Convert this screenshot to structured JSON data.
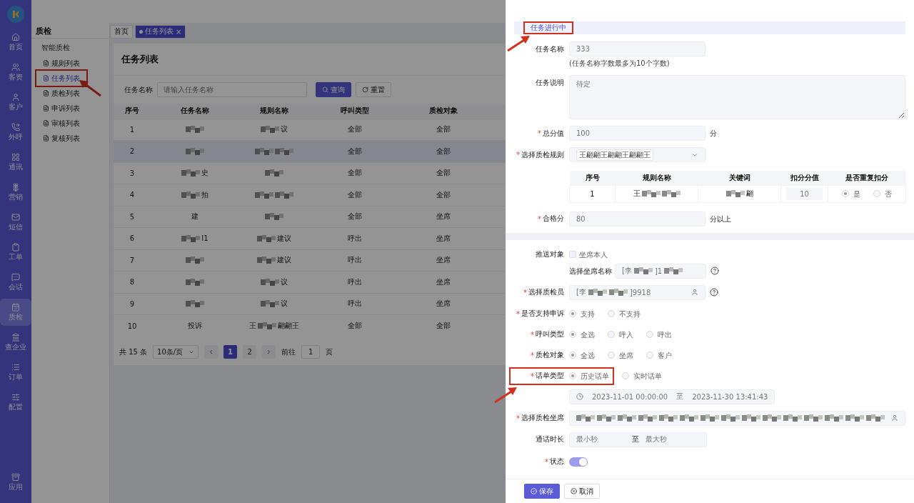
{
  "sidebar": {
    "items": [
      {
        "label": "首页",
        "selected": false
      },
      {
        "label": "客资",
        "selected": false
      },
      {
        "label": "客户",
        "selected": false
      },
      {
        "label": "外呼",
        "selected": false
      },
      {
        "label": "通讯",
        "selected": false
      },
      {
        "label": "营销",
        "selected": false
      },
      {
        "label": "短信",
        "selected": false
      },
      {
        "label": "工单",
        "selected": false
      },
      {
        "label": "会话",
        "selected": false
      },
      {
        "label": "质检",
        "selected": true
      },
      {
        "label": "查企业",
        "selected": false
      },
      {
        "label": "订单",
        "selected": false
      },
      {
        "label": "配置",
        "selected": false
      }
    ],
    "bottom_item": {
      "label": "应用"
    }
  },
  "submenu": {
    "title": "质检",
    "group": "智能质检",
    "items": [
      {
        "label": "规则列表",
        "selected": false,
        "annotated": false
      },
      {
        "label": "任务列表",
        "selected": true,
        "annotated": true
      },
      {
        "label": "质检列表",
        "selected": false,
        "annotated": false
      },
      {
        "label": "申诉列表",
        "selected": false,
        "annotated": false
      },
      {
        "label": "审核列表",
        "selected": false,
        "annotated": false
      },
      {
        "label": "复核列表",
        "selected": false,
        "annotated": false
      }
    ]
  },
  "tabs": [
    {
      "label": "首页",
      "selected": false
    },
    {
      "label": "任务列表",
      "selected": true,
      "close": "×"
    }
  ],
  "page": {
    "title": "任务列表",
    "search": {
      "label": "任务名称",
      "placeholder": "请输入任务名称"
    },
    "buttons": [
      {
        "label": "查询",
        "kind": "primary"
      },
      {
        "label": "重置",
        "kind": "default"
      }
    ]
  },
  "table": {
    "columns": [
      "序号",
      "任务名称",
      "规则名称",
      "呼叫类型",
      "质检对象"
    ],
    "rows": [
      {
        "selected": false,
        "cells": [
          [
            {
              "kind": "text",
              "text": "1"
            }
          ],
          [
            {
              "kind": "redacted"
            }
          ],
          [
            {
              "kind": "redacted"
            },
            {
              "kind": "text",
              "text": "议"
            }
          ],
          [
            {
              "kind": "text",
              "text": "全部"
            }
          ],
          [
            {
              "kind": "text",
              "text": "全部"
            }
          ]
        ]
      },
      {
        "selected": true,
        "cells": [
          [
            {
              "kind": "text",
              "text": "2"
            }
          ],
          [
            {
              "kind": "redacted"
            }
          ],
          [
            {
              "kind": "redacted"
            },
            {
              "kind": "redacted"
            }
          ],
          [
            {
              "kind": "text",
              "text": "全部"
            }
          ],
          [
            {
              "kind": "text",
              "text": "全部"
            }
          ]
        ]
      },
      {
        "selected": false,
        "cells": [
          [
            {
              "kind": "text",
              "text": "3"
            }
          ],
          [
            {
              "kind": "redacted"
            },
            {
              "kind": "text",
              "text": "史"
            }
          ],
          [
            {
              "kind": "redacted"
            }
          ],
          [
            {
              "kind": "text",
              "text": "全部"
            }
          ],
          [
            {
              "kind": "text",
              "text": "全部"
            }
          ]
        ]
      },
      {
        "selected": false,
        "cells": [
          [
            {
              "kind": "text",
              "text": "4"
            }
          ],
          [
            {
              "kind": "redacted"
            },
            {
              "kind": "text",
              "text": "拍"
            }
          ],
          [
            {
              "kind": "redacted"
            },
            {
              "kind": "redacted"
            }
          ],
          [
            {
              "kind": "text",
              "text": "全部"
            }
          ],
          [
            {
              "kind": "text",
              "text": "全部"
            }
          ]
        ]
      },
      {
        "selected": false,
        "cells": [
          [
            {
              "kind": "text",
              "text": "5"
            }
          ],
          [
            {
              "kind": "text",
              "text": "建"
            }
          ],
          [
            {
              "kind": "redacted"
            }
          ],
          [
            {
              "kind": "text",
              "text": "全部"
            }
          ],
          [
            {
              "kind": "text",
              "text": "坐席"
            }
          ]
        ]
      },
      {
        "selected": false,
        "cells": [
          [
            {
              "kind": "text",
              "text": "6"
            }
          ],
          [
            {
              "kind": "redacted"
            },
            {
              "kind": "text",
              "text": "I1"
            }
          ],
          [
            {
              "kind": "redacted"
            },
            {
              "kind": "text",
              "text": "建议"
            }
          ],
          [
            {
              "kind": "text",
              "text": "呼出"
            }
          ],
          [
            {
              "kind": "text",
              "text": "坐席"
            }
          ]
        ]
      },
      {
        "selected": false,
        "cells": [
          [
            {
              "kind": "text",
              "text": "7"
            }
          ],
          [
            {
              "kind": "redacted"
            }
          ],
          [
            {
              "kind": "redacted"
            },
            {
              "kind": "text",
              "text": "建议"
            }
          ],
          [
            {
              "kind": "text",
              "text": "呼出"
            }
          ],
          [
            {
              "kind": "text",
              "text": "坐席"
            }
          ]
        ]
      },
      {
        "selected": false,
        "cells": [
          [
            {
              "kind": "text",
              "text": "8"
            }
          ],
          [
            {
              "kind": "redacted"
            }
          ],
          [
            {
              "kind": "redacted"
            },
            {
              "kind": "text",
              "text": "议"
            }
          ],
          [
            {
              "kind": "text",
              "text": "呼出"
            }
          ],
          [
            {
              "kind": "text",
              "text": "坐席"
            }
          ]
        ]
      },
      {
        "selected": false,
        "cells": [
          [
            {
              "kind": "text",
              "text": "9"
            }
          ],
          [
            {
              "kind": "redacted"
            }
          ],
          [
            {
              "kind": "redacted"
            },
            {
              "kind": "text",
              "text": "议"
            }
          ],
          [
            {
              "kind": "text",
              "text": "呼出"
            }
          ],
          [
            {
              "kind": "text",
              "text": "坐席"
            }
          ]
        ]
      },
      {
        "selected": false,
        "cells": [
          [
            {
              "kind": "text",
              "text": "10"
            }
          ],
          [
            {
              "kind": "text",
              "text": "投诉"
            }
          ],
          [
            {
              "kind": "text",
              "text": "王"
            },
            {
              "kind": "redacted"
            },
            {
              "kind": "text",
              "text": "翩翩王"
            }
          ],
          [
            {
              "kind": "text",
              "text": "全部"
            }
          ],
          [
            {
              "kind": "text",
              "text": "全部"
            }
          ]
        ]
      }
    ]
  },
  "pagination": {
    "total": "共 15 条",
    "page_size": "10条/页",
    "pages": [
      {
        "label": "1",
        "selected": true
      },
      {
        "label": "2",
        "selected": false
      }
    ],
    "goto_label": "前往",
    "goto_value": "1",
    "goto_suffix": "页"
  },
  "drawer": {
    "section": {
      "title": "任务进行中",
      "annotated": true
    },
    "fields": [
      {
        "kind": "input",
        "label": "任务名称",
        "value": [
          {
            "kind": "text",
            "text": "333"
          }
        ],
        "hint": "(任务名称字数最多为10个字数)"
      },
      {
        "kind": "textarea",
        "label": "任务说明",
        "value": "待定"
      },
      {
        "kind": "input",
        "label": "总分值",
        "required_mark": "*",
        "value": [
          {
            "kind": "text",
            "text": "100"
          }
        ],
        "suffix": "分"
      },
      {
        "kind": "select",
        "label": "选择质检规则",
        "required_mark": "*",
        "tags": [
          "王翩翩王翩翩王翩翩王"
        ]
      },
      {
        "kind": "rule_table",
        "columns": [
          "序号",
          "规则名称",
          "关键词",
          "扣分分值",
          "是否重复扣分"
        ],
        "rows": [
          {
            "cells": [
              [
                {
                  "kind": "text",
                  "text": "1"
                }
              ],
              [
                {
                  "kind": "text",
                  "text": "王"
                },
                {
                  "kind": "redacted"
                },
                {
                  "kind": "redacted"
                }
              ],
              [
                {
                  "kind": "redacted"
                },
                {
                  "kind": "text",
                  "text": "翩"
                }
              ]
            ],
            "score": "10",
            "repeat": [
              {
                "label": "是",
                "selected": true
              },
              {
                "label": "否",
                "selected": false
              }
            ]
          }
        ]
      },
      {
        "kind": "input",
        "label": "合格分",
        "required_mark": "*",
        "value": [
          {
            "kind": "text",
            "text": "80"
          }
        ],
        "suffix": "分以上"
      },
      {
        "kind": "divider"
      },
      {
        "kind": "checkbox",
        "label": "推送对象",
        "option": {
          "label": "坐席本人",
          "checked": false
        }
      },
      {
        "kind": "input",
        "inline_label": "选择坐席名称",
        "value": [
          {
            "kind": "text",
            "text": "[李"
          },
          {
            "kind": "redacted"
          },
          {
            "kind": "text",
            "text": "]1"
          },
          {
            "kind": "redacted"
          }
        ],
        "help": true
      },
      {
        "kind": "input",
        "label": "选择质检员",
        "required_mark": "*",
        "value": [
          {
            "kind": "text",
            "text": "[李"
          },
          {
            "kind": "redacted"
          },
          {
            "kind": "redacted"
          },
          {
            "kind": "text",
            "text": "]9918"
          }
        ],
        "user_icon": true,
        "help": true
      },
      {
        "kind": "radio",
        "label": "是否支持申诉",
        "required_mark": "*",
        "options": [
          {
            "label": "支持",
            "selected": true
          },
          {
            "label": "不支持",
            "selected": false
          }
        ]
      },
      {
        "kind": "radio",
        "label": "呼叫类型",
        "required_mark": "*",
        "options": [
          {
            "label": "全选",
            "selected": true
          },
          {
            "label": "呼入",
            "selected": false
          },
          {
            "label": "呼出",
            "selected": false
          }
        ]
      },
      {
        "kind": "radio",
        "label": "质检对象",
        "required_mark": "*",
        "options": [
          {
            "label": "全选",
            "selected": true
          },
          {
            "label": "坐席",
            "selected": false
          },
          {
            "label": "客户",
            "selected": false
          }
        ]
      },
      {
        "kind": "radio",
        "label": "话单类型",
        "required_mark": "*",
        "annotated": true,
        "options": [
          {
            "label": "历史话单",
            "selected": true
          },
          {
            "label": "实时话单",
            "selected": false
          }
        ]
      },
      {
        "kind": "date_range",
        "start": "2023-11-01 00:00:00",
        "separator": "至",
        "end": "2023-11-30 13:41:43"
      },
      {
        "kind": "input",
        "label": "选择质检坐席",
        "required_mark": "*",
        "wide": true,
        "value": [
          {
            "kind": "redacted"
          },
          {
            "kind": "redacted"
          },
          {
            "kind": "redacted"
          },
          {
            "kind": "redacted"
          },
          {
            "kind": "redacted"
          },
          {
            "kind": "redacted"
          },
          {
            "kind": "redacted"
          },
          {
            "kind": "redacted"
          },
          {
            "kind": "redacted"
          },
          {
            "kind": "redacted"
          },
          {
            "kind": "redacted"
          },
          {
            "kind": "redacted"
          },
          {
            "kind": "redacted"
          },
          {
            "kind": "redacted"
          },
          {
            "kind": "redacted"
          }
        ],
        "user_icon": true
      },
      {
        "kind": "range",
        "label": "通话时长",
        "min_placeholder": "最小秒",
        "separator": "至",
        "max_placeholder": "最大秒"
      },
      {
        "kind": "toggle",
        "label": "状态",
        "required_mark": "*",
        "on": true
      }
    ],
    "buttons": [
      {
        "label": "保存",
        "kind": "primary"
      },
      {
        "label": "取消",
        "kind": "default"
      }
    ]
  }
}
